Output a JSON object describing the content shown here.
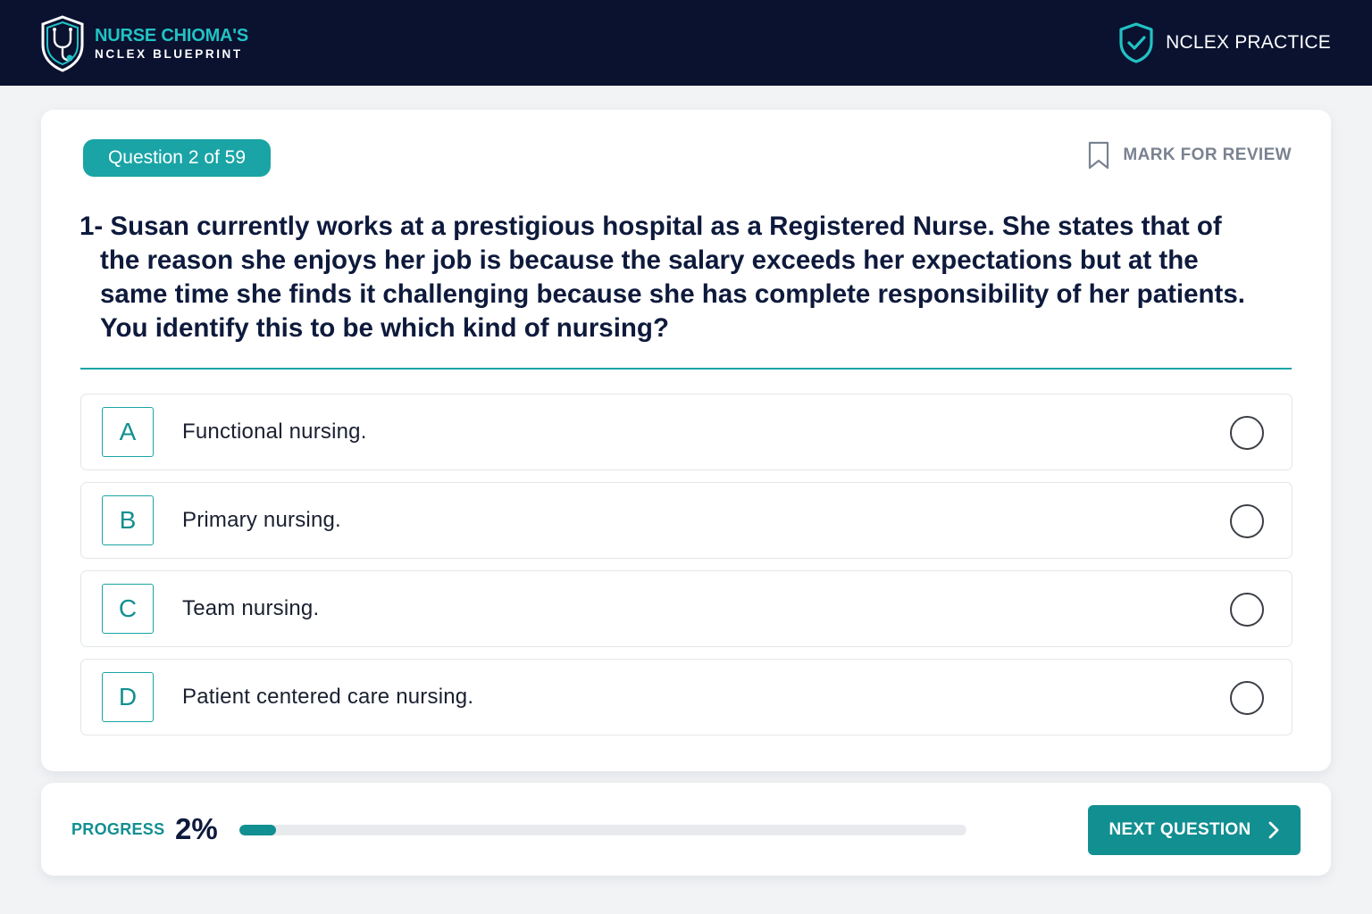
{
  "colors": {
    "accent": "#1aa4a6",
    "accent_dark": "#128f91",
    "brand": "#22c2c4",
    "header_bg": "#0a1230",
    "text": "#0e1a3c"
  },
  "header": {
    "brand_title": "NURSE CHIOMA'S",
    "brand_subtitle": "NCLEX BLUEPRINT",
    "brand_icon": "shield-stethoscope-icon",
    "mode_label": "NCLEX PRACTICE",
    "mode_icon": "shield-check-icon"
  },
  "question": {
    "badge": "Question 2 of 59",
    "mark_review_label": "MARK FOR REVIEW",
    "mark_review_icon": "bookmark-icon",
    "text": "1- Susan currently works at a  prestigious hospital as a Registered Nurse. She states that of the reason she enjoys her job is because the salary exceeds her expectations but at the same time she finds it challenging because she has complete responsibility of her patients. You identify this to be which kind of nursing?",
    "options": [
      {
        "letter": "A",
        "text": "Functional nursing."
      },
      {
        "letter": "B",
        "text": "Primary nursing."
      },
      {
        "letter": "C",
        "text": "Team nursing."
      },
      {
        "letter": "D",
        "text": "Patient centered care nursing."
      }
    ]
  },
  "footer": {
    "progress_label": "PROGRESS",
    "progress_text": "2%",
    "progress_value": 0.05,
    "next_label": "NEXT QUESTION",
    "next_icon": "chevron-right-icon"
  }
}
